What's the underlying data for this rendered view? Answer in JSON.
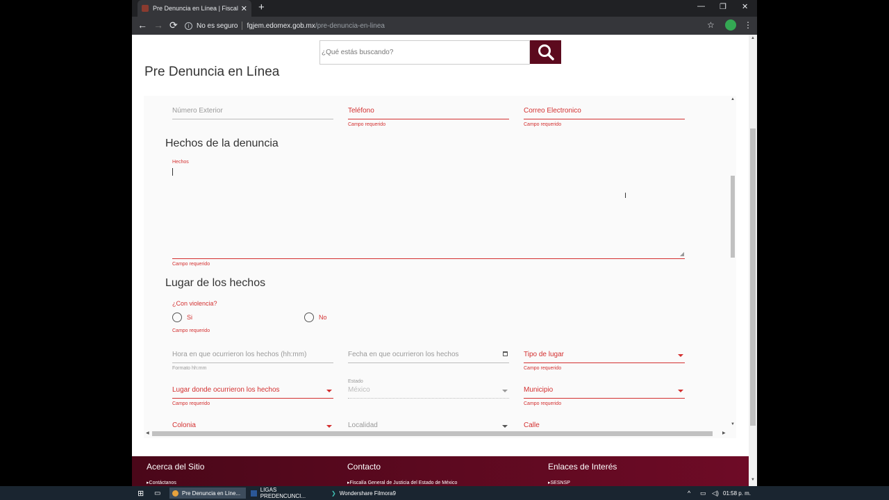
{
  "browser": {
    "tab_title": "Pre Denuncia en Línea | Fiscalía G",
    "close": "✕",
    "new_tab": "+",
    "minimize": "—",
    "maximize": "❐",
    "close_win": "✕",
    "back": "←",
    "forward": "→",
    "reload": "⟳",
    "info": "i",
    "security": "No es seguro",
    "url_host": "fgjem.edomex.gob.mx",
    "url_path": "/pre-denuncia-en-linea",
    "star": "☆",
    "menu": "⋮"
  },
  "header": {
    "search_placeholder": "¿Qué estás buscando?",
    "page_title": "Pre Denuncia en Línea"
  },
  "form": {
    "row1": [
      {
        "label": "Número Exterior",
        "error": ""
      },
      {
        "label": "Teléfono",
        "error": "Campo requerido"
      },
      {
        "label": "Correo Electronico",
        "error": "Campo requerido"
      }
    ],
    "section_hechos": "Hechos de la denuncia",
    "hechos_label": "Hechos",
    "hechos_error": "Campo requerido",
    "section_lugar": "Lugar de los hechos",
    "violencia_label": "¿Con violencia?",
    "violencia_options": [
      "Si",
      "No"
    ],
    "violencia_error": "Campo requerido",
    "hora_label": "Hora en que ocurrieron los hechos (hh:mm)",
    "hora_hint": "Formato hh:mm",
    "fecha_label": "Fecha en que ocurrieron los hechos",
    "tipo_lugar_label": "Tipo de lugar",
    "tipo_lugar_error": "Campo requerido",
    "lugar_label": "Lugar donde ocurrieron los hechos",
    "lugar_error": "Campo requerido",
    "estado_label": "Estado",
    "estado_value": "México",
    "municipio_label": "Municipio",
    "municipio_error": "Campo requerido",
    "colonia_label": "Colonia",
    "localidad_label": "Localidad",
    "calle_label": "Calle"
  },
  "footer": {
    "col1_title": "Acerca del Sitio",
    "col1_link": "Contáctanos",
    "col2_title": "Contacto",
    "col2_link": "Fiscalía General de Justicia del Estado de México",
    "col3_title": "Enlaces de Interés",
    "col3_link": "SESNSP"
  },
  "taskbar": {
    "items": [
      "Pre Denuncia en Líne...",
      "LIGAS PREDENCUNCI...",
      "Wondershare Filmora9"
    ],
    "clock": "01:58 p. m."
  }
}
